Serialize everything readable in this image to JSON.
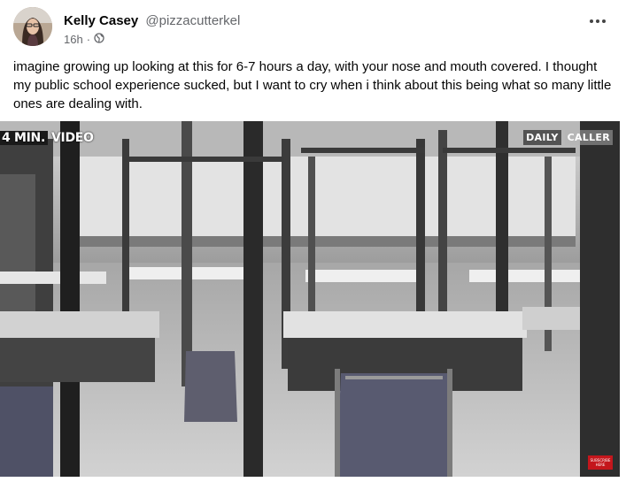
{
  "author": {
    "display_name": "Kelly Casey",
    "handle": "@pizzacutterkel",
    "time_ago": "16h",
    "separator": "·",
    "privacy_icon": "globe-icon",
    "avatar_icon": "user-avatar"
  },
  "post": {
    "text": "imagine growing up looking at this for 6-7 hours a day, with your nose and mouth covered. I thought my public school experience sucked, but I want to cry when i think about this being what so many little ones are dealing with.",
    "more_icon": "more-options-icon"
  },
  "video": {
    "badge_box": "4 MIN.",
    "badge_text": "VIDEO",
    "logo_part1": "DAILY",
    "logo_part2": "CALLER",
    "subscribe_label": "SUBSCRIBE HERE",
    "colors": {
      "floor": "#c9c9c9",
      "wall": "#e6e6e6",
      "dark": "#2a2a2a"
    }
  }
}
